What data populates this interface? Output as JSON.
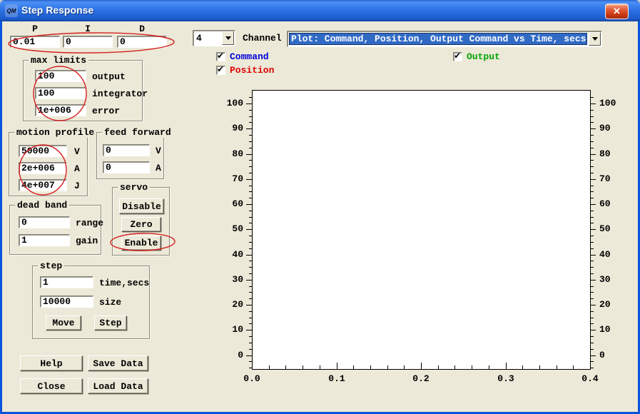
{
  "window": {
    "title": "Step Response",
    "close_glyph": "✕",
    "icon_text": "QM"
  },
  "pid": {
    "labels": [
      "P",
      "I",
      "D"
    ],
    "values": [
      "0.01",
      "0",
      "0"
    ]
  },
  "channel": {
    "value": "4",
    "label": "Channel"
  },
  "plot_selector": {
    "value": "Plot: Command, Position, Output Command vs Time, secs"
  },
  "traces": [
    {
      "label": "Command",
      "checked": true,
      "color": "#0000dd"
    },
    {
      "label": "Position",
      "checked": true,
      "color": "#e00000"
    },
    {
      "label": "Output",
      "checked": true,
      "color": "#00a400"
    }
  ],
  "max_limits": {
    "title": "max limits",
    "rows": [
      {
        "value": "100",
        "label": "output"
      },
      {
        "value": "100",
        "label": "integrator"
      },
      {
        "value": "1e+006",
        "label": "error"
      }
    ]
  },
  "motion_profile": {
    "title": "motion profile",
    "rows": [
      {
        "value": "50000",
        "label": "V"
      },
      {
        "value": "2e+006",
        "label": "A"
      },
      {
        "value": "4e+007",
        "label": "J"
      }
    ]
  },
  "feed_forward": {
    "title": "feed forward",
    "rows": [
      {
        "value": "0",
        "label": "V"
      },
      {
        "value": "0",
        "label": "A"
      }
    ]
  },
  "servo": {
    "title": "servo",
    "buttons": [
      "Disable",
      "Zero",
      "Enable"
    ]
  },
  "dead_band": {
    "title": "dead band",
    "rows": [
      {
        "value": "0",
        "label": "range"
      },
      {
        "value": "1",
        "label": "gain"
      }
    ]
  },
  "step": {
    "title": "step",
    "rows": [
      {
        "value": "1",
        "label": "time,secs"
      },
      {
        "value": "10000",
        "label": "size"
      }
    ],
    "buttons": [
      "Move",
      "Step"
    ]
  },
  "bottom_buttons": [
    "Help",
    "Save Data",
    "Close",
    "Load Data"
  ],
  "annotations": {
    "color": "#d62020",
    "targets": [
      "pid-fields",
      "max-limits-values",
      "motion-profile-values",
      "enable-button"
    ]
  },
  "chart_data": {
    "type": "line",
    "title": "",
    "xlabel": "",
    "ylabel": "",
    "x_ticks": [
      "0.0",
      "0.1",
      "0.2",
      "0.3",
      "0.4"
    ],
    "y_ticks": [
      "0",
      "10",
      "20",
      "30",
      "40",
      "50",
      "60",
      "70",
      "80",
      "90",
      "100"
    ],
    "x_range": [
      0.0,
      0.4
    ],
    "y_range": [
      0,
      100
    ],
    "x_minor_step": 0.02,
    "y_minor_step": 2.5,
    "dual_y_axis": true,
    "grid": false,
    "series": []
  },
  "colors": {
    "client_bg": "#ECE9D8",
    "titlebar_blue": "#2e73e6",
    "selection_bg": "#316ac5",
    "annotation_red": "#d62020"
  }
}
